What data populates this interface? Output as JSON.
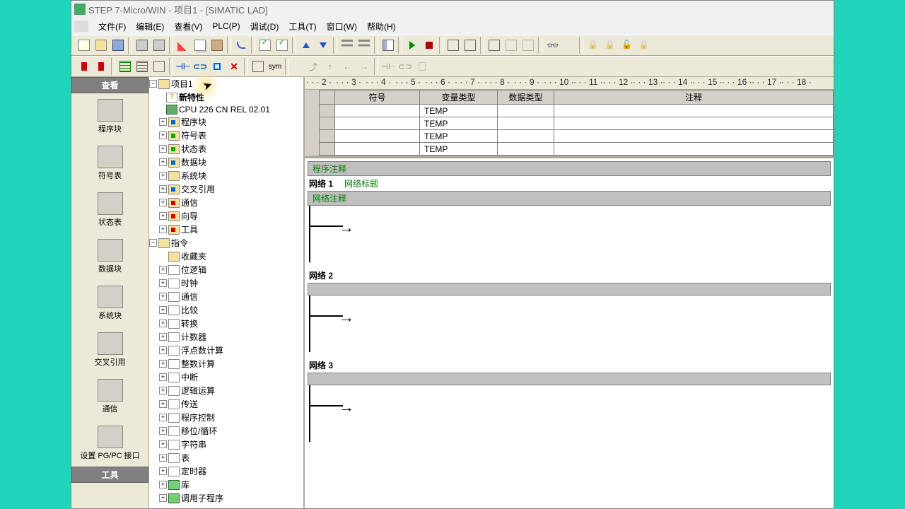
{
  "title": "STEP 7-Micro/WIN - 项目1 - [SIMATIC LAD]",
  "menus": [
    "文件(F)",
    "编辑(E)",
    "查看(V)",
    "PLC(P)",
    "调试(D)",
    "工具(T)",
    "窗口(W)",
    "帮助(H)"
  ],
  "sidebar": {
    "header": "查看",
    "items": [
      {
        "label": "程序块"
      },
      {
        "label": "符号表"
      },
      {
        "label": "状态表"
      },
      {
        "label": "数据块"
      },
      {
        "label": "系统块"
      },
      {
        "label": "交叉引用"
      },
      {
        "label": "通信"
      },
      {
        "label": "设置 PG/PC 接口"
      }
    ],
    "footer": "工具"
  },
  "tree": {
    "root": "项目1",
    "props": "新特性",
    "cpu": "CPU 226 CN REL 02.01",
    "nodes": [
      {
        "label": "程序块",
        "icon": "blue"
      },
      {
        "label": "符号表",
        "icon": "green"
      },
      {
        "label": "状态表",
        "icon": "green"
      },
      {
        "label": "数据块",
        "icon": "blue"
      },
      {
        "label": "系统块",
        "icon": "gray"
      },
      {
        "label": "交叉引用",
        "icon": "blue"
      },
      {
        "label": "通信",
        "icon": "red"
      },
      {
        "label": "向导",
        "icon": "red"
      },
      {
        "label": "工具",
        "icon": "red"
      }
    ],
    "instr_root": "指令",
    "instr": [
      {
        "label": "收藏夹"
      },
      {
        "label": "位逻辑"
      },
      {
        "label": "时钟"
      },
      {
        "label": "通信"
      },
      {
        "label": "比较"
      },
      {
        "label": "转换"
      },
      {
        "label": "计数器"
      },
      {
        "label": "浮点数计算"
      },
      {
        "label": "整数计算"
      },
      {
        "label": "中断"
      },
      {
        "label": "逻辑运算"
      },
      {
        "label": "传送"
      },
      {
        "label": "程序控制"
      },
      {
        "label": "移位/循环"
      },
      {
        "label": "字符串"
      },
      {
        "label": "表"
      },
      {
        "label": "定时器"
      },
      {
        "label": "库"
      },
      {
        "label": "调用子程序"
      }
    ]
  },
  "ruler_marks": [
    "2",
    "3",
    "4",
    "5",
    "6",
    "7",
    "8",
    "9",
    "10",
    "11",
    "12",
    "13",
    "14",
    "15",
    "16",
    "17",
    "18"
  ],
  "var_table": {
    "headers": [
      "",
      "符号",
      "变量类型",
      "数据类型",
      "注释"
    ],
    "rows": [
      {
        "symbol": "",
        "vartype": "TEMP",
        "datatype": "",
        "comment": ""
      },
      {
        "symbol": "",
        "vartype": "TEMP",
        "datatype": "",
        "comment": ""
      },
      {
        "symbol": "",
        "vartype": "TEMP",
        "datatype": "",
        "comment": ""
      },
      {
        "symbol": "",
        "vartype": "TEMP",
        "datatype": "",
        "comment": ""
      }
    ]
  },
  "lad": {
    "prog_comment": "程序注释",
    "networks": [
      {
        "label": "网络 1",
        "title": "网络标题",
        "comment": "网络注释"
      },
      {
        "label": "网络 2",
        "title": "",
        "comment": ""
      },
      {
        "label": "网络 3",
        "title": "",
        "comment": ""
      }
    ]
  },
  "toolbar2_sym": "sym"
}
